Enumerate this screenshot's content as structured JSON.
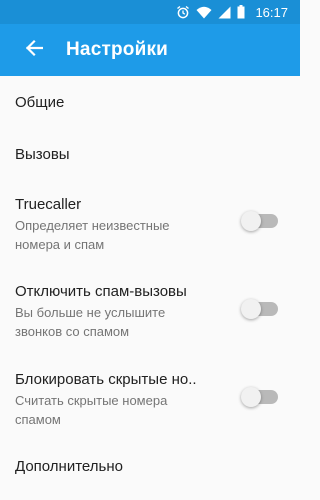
{
  "status_bar": {
    "time": "16:17",
    "icons": [
      "alarm-icon",
      "wifi-icon",
      "signal-icon",
      "battery-icon"
    ]
  },
  "app_bar": {
    "title": "Настройки",
    "back_icon": "arrow-back-icon"
  },
  "settings": [
    {
      "title": "Общие"
    },
    {
      "title": "Вызовы"
    },
    {
      "title": "Truecaller",
      "subtitle": "Определяет неизвестные номера и спам",
      "toggle_on": false
    },
    {
      "title": "Отключить спам-вызовы",
      "subtitle": "Вы больше не услышите звонков со спамом",
      "toggle_on": false
    },
    {
      "title": "Блокировать скрытые но..",
      "subtitle": "Считать скрытые номера спамом",
      "toggle_on": false
    },
    {
      "title": "Дополнительно"
    }
  ],
  "colors": {
    "status_bar": "#1a8fd6",
    "app_bar": "#1e9be8",
    "toggle_track_off": "#b9b9b9",
    "toggle_thumb_off": "#f1f1f1"
  }
}
